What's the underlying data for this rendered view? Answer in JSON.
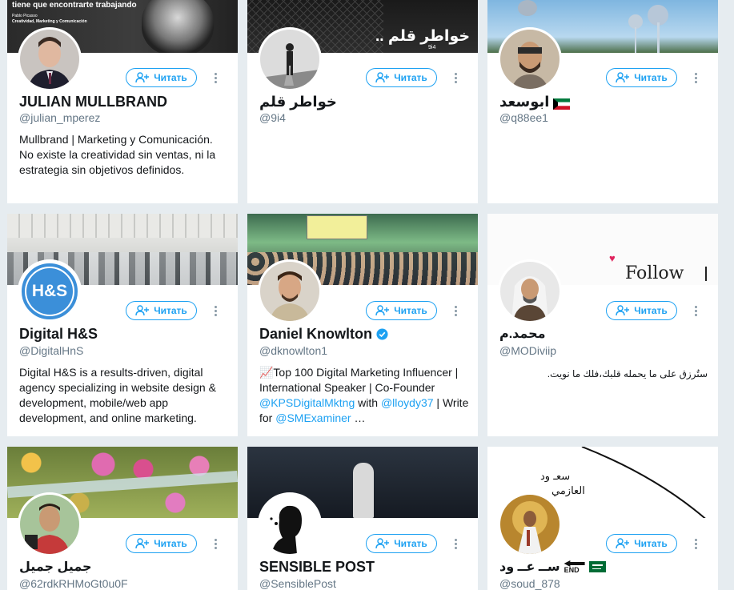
{
  "colors": {
    "page_bg": "#e6ecf0",
    "accent": "#1da1f2",
    "handle": "#657786"
  },
  "follow_label": "Читать",
  "cards": [
    {
      "name": "JULIAN MULLBRAND",
      "handle": "@julian_mperez",
      "bio": "Mullbrand | Marketing y Comunicación. No existe la creatividad sin ventas, ni la estrategia sin objetivos definidos.",
      "banner_text": "tiene que encontrarte trabajando",
      "banner_subtext": "Pablo Picasso",
      "banner_subtext2": "Creatividad, Marketing y Comunicación"
    },
    {
      "name": "خواطر قلم",
      "handle": "@9i4",
      "banner_text": "خواطر قلم ..",
      "banner_subtext": "9i4"
    },
    {
      "name": "ابوسعد",
      "handle": "@q88ee1",
      "flag": "kuwait-flag-icon"
    },
    {
      "name": "Digital H&S",
      "handle": "@DigitalHnS",
      "avatar_text": "H&S",
      "bio": "Digital H&S is a results-driven, digital agency specializing in website design & development, mobile/web app development, and online marketing."
    },
    {
      "name": "Daniel Knowlton",
      "handle": "@dknowlton1",
      "bio_parts": [
        {
          "text": "📈Top 100 Digital Marketing Influencer | International Speaker | Co-Founder ",
          "link": false
        },
        {
          "text": "@KPSDigitalMktng",
          "link": true
        },
        {
          "text": " with ",
          "link": false
        },
        {
          "text": "@lloydy37",
          "link": true
        },
        {
          "text": " | Write for ",
          "link": false
        },
        {
          "text": "@SMExaminer",
          "link": true
        },
        {
          "text": " …",
          "link": false
        }
      ]
    },
    {
      "name": "محمد.م",
      "handle": "@MODiviip",
      "bio": "ستُرزق على ما يحمله قلبك،فلك ما نويت.",
      "banner_text": "Follow"
    },
    {
      "name": "جميل جميل",
      "handle": "@62rdkRHMoGt0u0F"
    },
    {
      "name": "SENSIBLE POST",
      "handle": "@SensiblePost"
    },
    {
      "name": "ســ عــ ود",
      "handle": "@soud_878",
      "end_label": "END",
      "banner_text": "سعـ ود",
      "banner_subtext": "العازمي"
    }
  ]
}
